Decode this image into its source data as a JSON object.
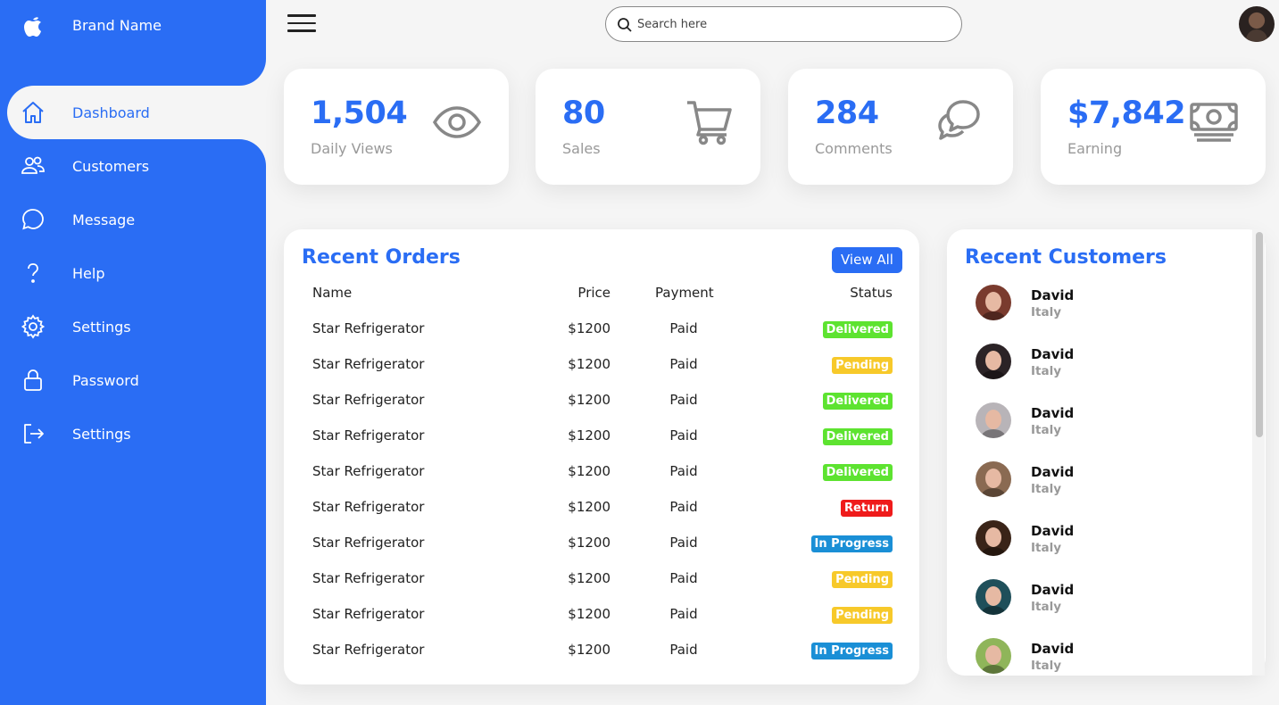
{
  "colors": {
    "accent": "#2a6df4",
    "delivered": "#5de330",
    "pending": "#f7c92a",
    "return": "#ef1b1b",
    "in_progress": "#1a8fd6"
  },
  "sidebar": {
    "brand": {
      "label": "Brand Name",
      "icon": "apple-icon"
    },
    "items": [
      {
        "label": "Dashboard",
        "icon": "home-icon",
        "active": true
      },
      {
        "label": "Customers",
        "icon": "people-icon"
      },
      {
        "label": "Message",
        "icon": "chat-icon"
      },
      {
        "label": "Help",
        "icon": "help-icon"
      },
      {
        "label": "Settings",
        "icon": "gear-icon"
      },
      {
        "label": "Password",
        "icon": "lock-icon"
      },
      {
        "label": "Settings",
        "icon": "logout-icon"
      }
    ]
  },
  "topbar": {
    "search_placeholder": "Search here",
    "menu_icon": "hamburger-icon",
    "search_icon": "search-icon"
  },
  "cards": [
    {
      "number": "1,504",
      "label": "Daily Views",
      "icon": "eye-icon"
    },
    {
      "number": "80",
      "label": "Sales",
      "icon": "cart-icon"
    },
    {
      "number": "284",
      "label": "Comments",
      "icon": "comments-icon"
    },
    {
      "number": "$7,842",
      "label": "Earning",
      "icon": "cash-icon"
    }
  ],
  "orders": {
    "title": "Recent Orders",
    "view_all": "View All",
    "headers": {
      "name": "Name",
      "price": "Price",
      "payment": "Payment",
      "status": "Status"
    },
    "rows": [
      {
        "name": "Star Refrigerator",
        "price": "$1200",
        "payment": "Paid",
        "status": "Delivered",
        "kind": "delivered"
      },
      {
        "name": "Star Refrigerator",
        "price": "$1200",
        "payment": "Paid",
        "status": "Pending",
        "kind": "pending"
      },
      {
        "name": "Star Refrigerator",
        "price": "$1200",
        "payment": "Paid",
        "status": "Delivered",
        "kind": "delivered"
      },
      {
        "name": "Star Refrigerator",
        "price": "$1200",
        "payment": "Paid",
        "status": "Delivered",
        "kind": "delivered"
      },
      {
        "name": "Star Refrigerator",
        "price": "$1200",
        "payment": "Paid",
        "status": "Delivered",
        "kind": "delivered"
      },
      {
        "name": "Star Refrigerator",
        "price": "$1200",
        "payment": "Paid",
        "status": "Return",
        "kind": "return"
      },
      {
        "name": "Star Refrigerator",
        "price": "$1200",
        "payment": "Paid",
        "status": "In Progress",
        "kind": "in_progress"
      },
      {
        "name": "Star Refrigerator",
        "price": "$1200",
        "payment": "Paid",
        "status": "Pending",
        "kind": "pending"
      },
      {
        "name": "Star Refrigerator",
        "price": "$1200",
        "payment": "Paid",
        "status": "Pending",
        "kind": "pending"
      },
      {
        "name": "Star Refrigerator",
        "price": "$1200",
        "payment": "Paid",
        "status": "In Progress",
        "kind": "in_progress"
      }
    ]
  },
  "customers": {
    "title": "Recent Customers",
    "items": [
      {
        "name": "David",
        "country": "Italy",
        "photo": "#7a3b2e"
      },
      {
        "name": "David",
        "country": "Italy",
        "photo": "#2b2326"
      },
      {
        "name": "David",
        "country": "Italy",
        "photo": "#b8b4b8"
      },
      {
        "name": "David",
        "country": "Italy",
        "photo": "#8a6a52"
      },
      {
        "name": "David",
        "country": "Italy",
        "photo": "#3a2418"
      },
      {
        "name": "David",
        "country": "Italy",
        "photo": "#1f4f5a"
      },
      {
        "name": "David",
        "country": "Italy",
        "photo": "#8fb55a"
      }
    ]
  }
}
